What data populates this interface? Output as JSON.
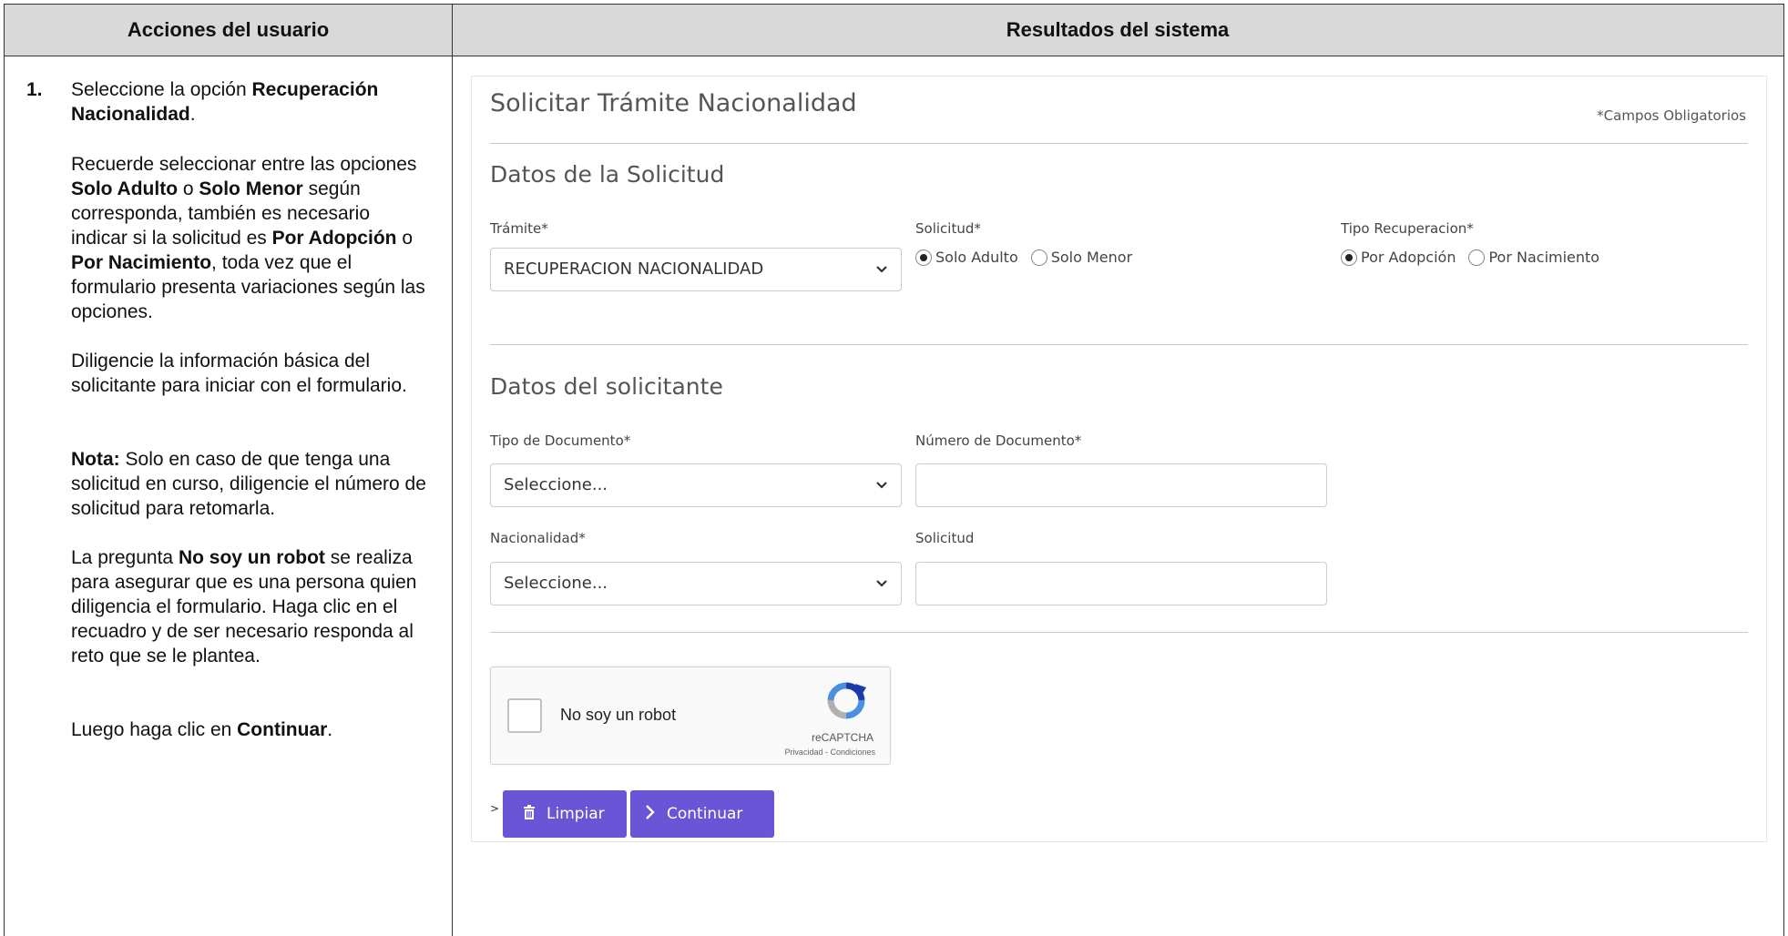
{
  "header": {
    "left_title": "Acciones del usuario",
    "right_title": "Resultados del sistema"
  },
  "instructions": {
    "step_number": "1.",
    "p1": {
      "t1": "Seleccione la opción ",
      "b1": "Recuperación Nacionalidad",
      "t2": "."
    },
    "p2": {
      "t1": "Recuerde seleccionar entre las opciones ",
      "b1": "Solo Adulto",
      "t2": " o ",
      "b2": "Solo Menor",
      "t3": " según corresponda, también es necesario indicar si la solicitud es ",
      "b3": "Por Adopción",
      "t4": " o ",
      "b4": "Por Nacimiento",
      "t5": ", toda vez que el formulario presenta variaciones según las opciones."
    },
    "p3": {
      "t1": "Diligencie la información básica del solicitante para iniciar con el formulario."
    },
    "p4": {
      "b1": "Nota:",
      "t1": " Solo en caso de que tenga una solicitud en curso, diligencie el número de solicitud para retomarla."
    },
    "p5": {
      "t1": "La pregunta ",
      "b1": "No soy un robot",
      "t2": " se realiza para asegurar que es una persona quien diligencia el formulario. Haga clic en el recuadro y de ser necesario responda al reto que se le plantea."
    },
    "p6": {
      "t1": "Luego haga clic en ",
      "b1": "Continuar",
      "t2": "."
    }
  },
  "form": {
    "title": "Solicitar Trámite Nacionalidad",
    "required_note": "*Campos Obligatorios",
    "section_request": "Datos de la Solicitud",
    "tramite_label": "Trámite",
    "tramite_value": "RECUPERACION NACIONALIDAD",
    "solicitud_type_label": "Solicitud",
    "solicitud_options": [
      "Solo Adulto",
      "Solo Menor"
    ],
    "solicitud_selected": "Solo Adulto",
    "recovery_label": "Tipo Recuperacion",
    "recovery_options": [
      "Por Adopción",
      "Por Nacimiento"
    ],
    "recovery_selected": "Por Adopción",
    "section_applicant": "Datos del solicitante",
    "doc_type_label": "Tipo de Documento",
    "doc_type_value": "Seleccione...",
    "doc_number_label": "Número de Documento",
    "doc_number_value": "",
    "nationality_label": "Nacionalidad",
    "nationality_value": "Seleccione...",
    "request_number_label": "Solicitud",
    "request_number_value": "",
    "required_mark": "*"
  },
  "captcha": {
    "label": "No soy un robot",
    "brand": "reCAPTCHA",
    "links": "Privacidad - Condiciones"
  },
  "actions": {
    "prefix": ">",
    "clear_label": "Limpiar",
    "continue_label": "Continuar"
  },
  "colors": {
    "button": "#6a55d6",
    "header_bg": "#d9d9d9"
  }
}
